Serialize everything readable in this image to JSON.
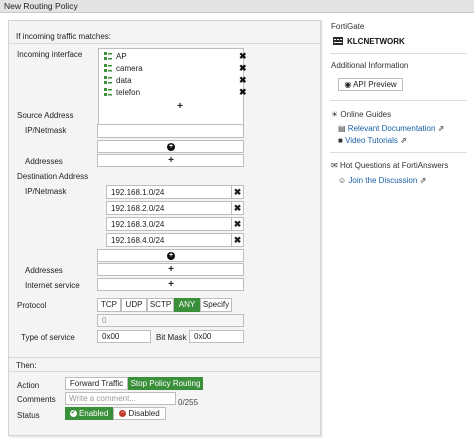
{
  "window": {
    "title": "New Routing Policy"
  },
  "form": {
    "match_header": "If incoming traffic matches:",
    "incoming_interface": {
      "label": "Incoming interface",
      "items": [
        "AP",
        "camera",
        "data",
        "telefon"
      ]
    },
    "source_address": {
      "heading": "Source Address",
      "ip_netmask_label": "IP/Netmask",
      "addresses_label": "Addresses"
    },
    "destination_address": {
      "heading": "Destination Address",
      "ip_netmask_label": "IP/Netmask",
      "entries": [
        "192.168.1.0/24",
        "192.168.2.0/24",
        "192.168.3.0/24",
        "192.168.4.0/24"
      ],
      "addresses_label": "Addresses",
      "internet_service_label": "Internet service"
    },
    "protocol": {
      "label": "Protocol",
      "options": [
        "TCP",
        "UDP",
        "SCTP",
        "ANY",
        "Specify"
      ],
      "selected": "ANY",
      "number_value": "0"
    },
    "type_of_service": {
      "label": "Type of service",
      "value": "0x00",
      "bitmask_label": "Bit Mask",
      "bitmask_value": "0x00"
    },
    "then_header": "Then:",
    "action": {
      "label": "Action",
      "options": [
        "Forward Traffic",
        "Stop Policy Routing"
      ],
      "selected": "Stop Policy Routing"
    },
    "comments": {
      "label": "Comments",
      "placeholder": "Write a comment...",
      "counter": "0/255"
    },
    "status": {
      "label": "Status",
      "enabled_label": "Enabled",
      "disabled_label": "Disabled",
      "selected": "Enabled"
    }
  },
  "sidebar": {
    "device_heading": "FortiGate",
    "device_name": "KLCNETWORK",
    "additional_info_heading": "Additional Information",
    "api_preview_label": "API Preview",
    "online_guides_heading": "Online Guides",
    "relevant_docs_label": "Relevant Documentation",
    "video_tutorials_label": "Video Tutorials",
    "hot_questions_heading": "Hot Questions at FortiAnswers",
    "join_discussion_label": "Join the Discussion"
  },
  "colors": {
    "accent_green": "#3a8f3a",
    "link_blue": "#1a5fa8",
    "disabled_red": "#c0392b"
  }
}
